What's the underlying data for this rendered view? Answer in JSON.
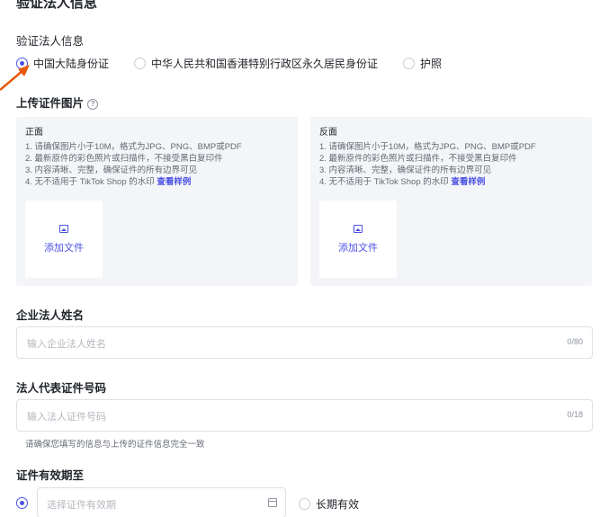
{
  "page": {
    "title": "验证法人信息"
  },
  "id_type": {
    "label": "验证法人信息",
    "options": [
      {
        "label": "中国大陆身份证",
        "checked": true
      },
      {
        "label": "中华人民共和国香港特别行政区永久居民身份证",
        "checked": false
      },
      {
        "label": "护照",
        "checked": false
      }
    ]
  },
  "upload": {
    "label": "上传证件图片",
    "help_icon": "?",
    "front": {
      "title": "正面",
      "rules": [
        "1. 请确保图片小于10M，格式为JPG、PNG、BMP或PDF",
        "2. 最新原件的彩色照片或扫描件，不接受黑白复印件",
        "3. 内容清晰、完整，确保证件的所有边界可见",
        "4. 无不适用于 TikTok Shop 的水印"
      ],
      "example_link": "查看样例",
      "add_label": "添加文件"
    },
    "back": {
      "title": "反面",
      "rules": [
        "1. 请确保图片小于10M，格式为JPG、PNG、BMP或PDF",
        "2. 最新原件的彩色照片或扫描件，不接受黑白复印件",
        "3. 内容清晰、完整，确保证件的所有边界可见",
        "4. 无不适用于 TikTok Shop 的水印"
      ],
      "example_link": "查看样例",
      "add_label": "添加文件"
    }
  },
  "legal_name": {
    "label": "企业法人姓名",
    "placeholder": "输入企业法人姓名",
    "count": "0/80"
  },
  "id_number": {
    "label": "法人代表证件号码",
    "placeholder": "输入法人证件号码",
    "count": "0/18",
    "hint": "请确保您填写的信息与上传的证件信息完全一致"
  },
  "validity": {
    "label": "证件有效期至",
    "placeholder": "选择证件有效期",
    "long_term_label": "长期有效"
  },
  "colors": {
    "accent": "#4b52e3",
    "arrow": "#e8590c"
  }
}
